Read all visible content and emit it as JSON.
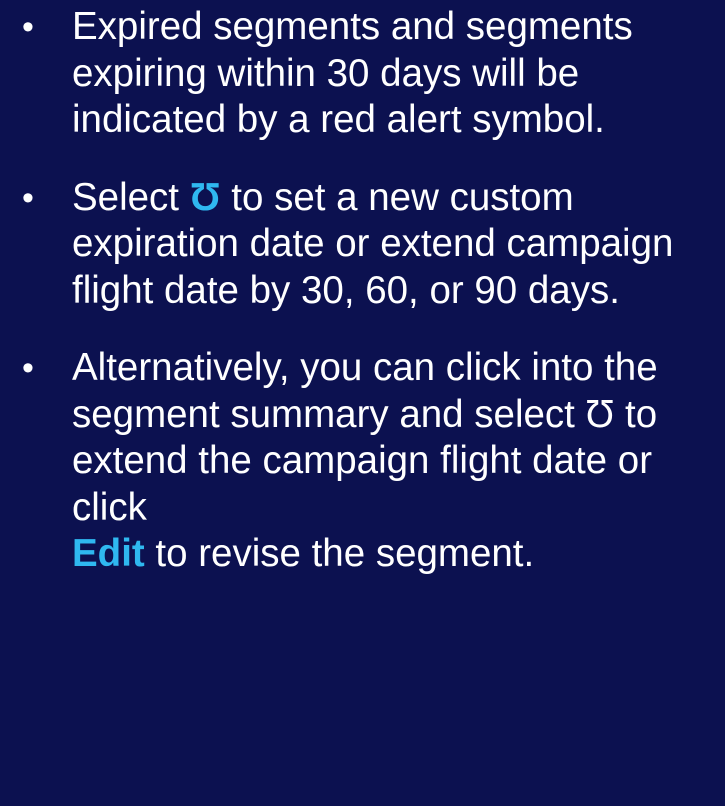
{
  "colors": {
    "background": "#0c1150",
    "text": "#ffffff",
    "accent": "#2fb8f0"
  },
  "bullet_char": "•",
  "icons": {
    "refresh": {
      "name": "refresh-icon",
      "glyph": "Ʊ"
    }
  },
  "items": [
    {
      "text": "Expired segments and segments expiring within 30 days will be indicated by a red alert symbol."
    },
    {
      "before": "Select ",
      "after": " to set a new custom expiration date or extend campaign flight date by 30, 60, or 90 days."
    },
    {
      "before": "Alternatively, you can click into the segment summary and select ",
      "middle": " to extend the campaign flight date or click ",
      "link": "Edit",
      "after": " to revise the segment."
    }
  ]
}
